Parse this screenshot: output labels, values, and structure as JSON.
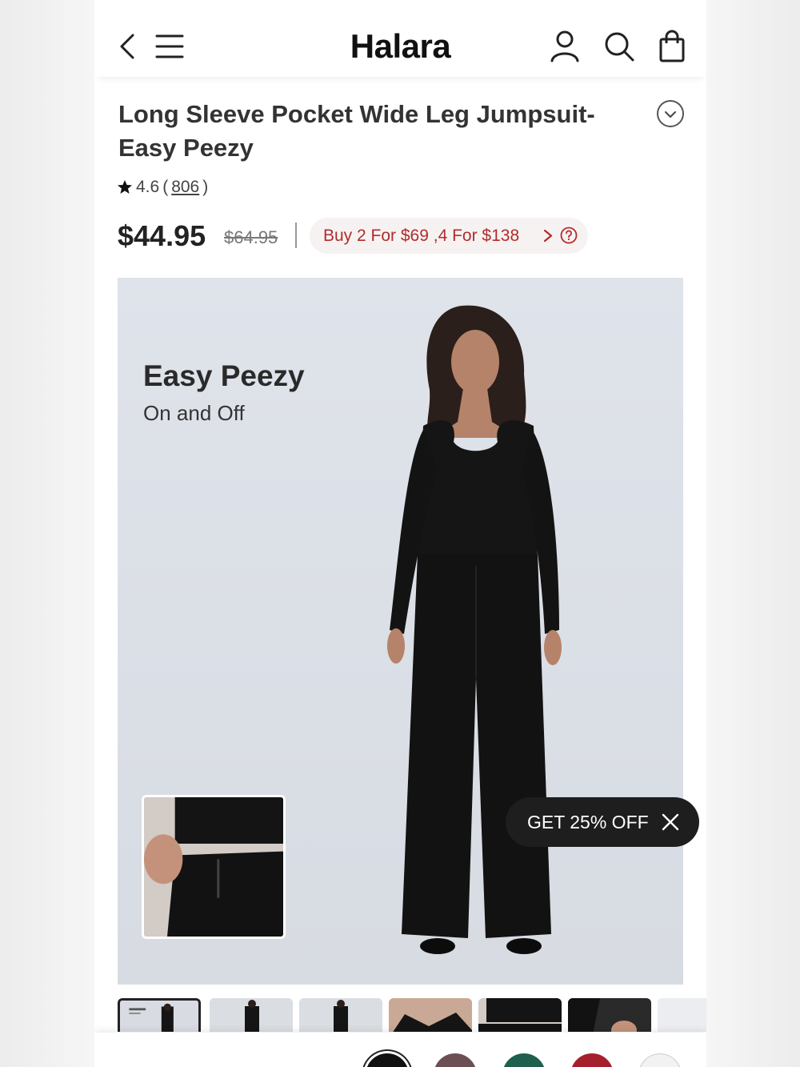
{
  "app": {
    "brand": "Halara"
  },
  "header": {
    "back_icon": "chevron-left-icon",
    "menu_icon": "hamburger-menu-icon",
    "account_icon": "user-icon",
    "search_icon": "search-icon",
    "bag_icon": "shopping-bag-icon"
  },
  "product": {
    "title": "Long Sleeve Pocket Wide Leg Jumpsuit-Easy Peezy",
    "rating": "4.6",
    "reviews_open": "(",
    "reviews_count": "806",
    "reviews_close": ")",
    "price": "$44.95",
    "original_price": "$64.95",
    "promo": "Buy 2 For $69 ,4 For $138"
  },
  "hero": {
    "title": "Easy Peezy",
    "subtitle": "On and Off"
  },
  "coupon": {
    "label": "GET 25% OFF"
  },
  "colors": {
    "accent": "#b12c2c",
    "swatches": [
      "#111111",
      "#6b4f55",
      "#1f5f4e",
      "#a5202d",
      "#f2f2f2"
    ]
  }
}
